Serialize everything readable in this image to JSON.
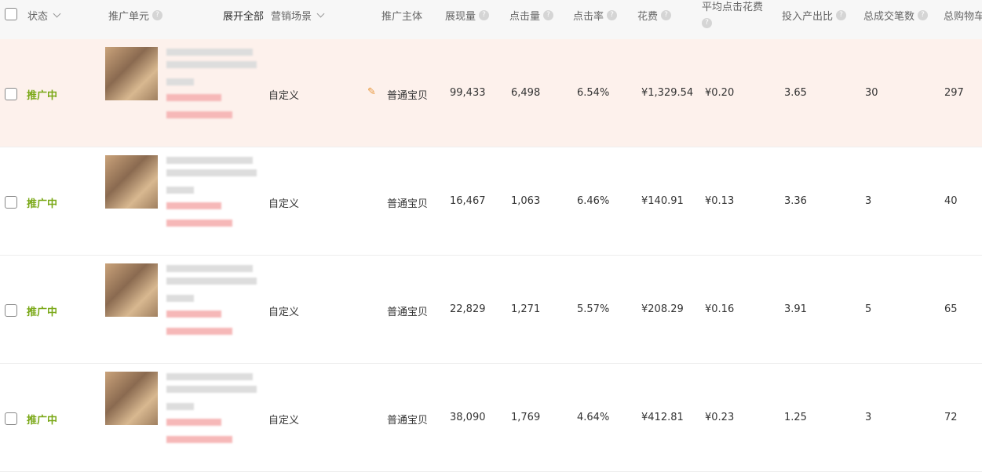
{
  "header": {
    "status": "状态",
    "unit": "推广单元",
    "expand_all": "展开全部",
    "scene": "营销场景",
    "subject": "推广主体",
    "impressions": "展现量",
    "clicks": "点击量",
    "ctr": "点击率",
    "cost": "花费",
    "avg_cpc": "平均点击花费",
    "roi": "投入产出比",
    "orders": "总成交笔数",
    "cart": "总购物车"
  },
  "colors": {
    "status": "#7aa817",
    "highlight": "#fdf1ec"
  },
  "rows": [
    {
      "status": "推广中",
      "scene": "自定义",
      "subject": "普通宝贝",
      "impressions": "99,433",
      "clicks": "6,498",
      "ctr": "6.54%",
      "cost": "¥1,329.54",
      "avg_cpc": "¥0.20",
      "roi": "3.65",
      "orders": "30",
      "cart": "297"
    },
    {
      "status": "推广中",
      "scene": "自定义",
      "subject": "普通宝贝",
      "impressions": "16,467",
      "clicks": "1,063",
      "ctr": "6.46%",
      "cost": "¥140.91",
      "avg_cpc": "¥0.13",
      "roi": "3.36",
      "orders": "3",
      "cart": "40"
    },
    {
      "status": "推广中",
      "scene": "自定义",
      "subject": "普通宝贝",
      "impressions": "22,829",
      "clicks": "1,271",
      "ctr": "5.57%",
      "cost": "¥208.29",
      "avg_cpc": "¥0.16",
      "roi": "3.91",
      "orders": "5",
      "cart": "65"
    },
    {
      "status": "推广中",
      "scene": "自定义",
      "subject": "普通宝贝",
      "impressions": "38,090",
      "clicks": "1,769",
      "ctr": "4.64%",
      "cost": "¥412.81",
      "avg_cpc": "¥0.23",
      "roi": "1.25",
      "orders": "3",
      "cart": "72"
    }
  ]
}
